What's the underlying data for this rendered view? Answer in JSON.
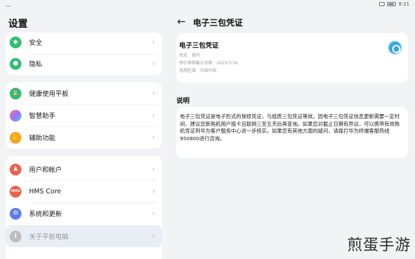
{
  "statusbar": {
    "wifi": "‿",
    "time": "8:21"
  },
  "settings_title": "设置",
  "groups": {
    "g1": [
      {
        "label": "安全",
        "icon": "shield-icon",
        "color": "#2fbf71"
      },
      {
        "label": "隐私",
        "icon": "privacy-icon",
        "color": "#2fbf71"
      }
    ],
    "g2": [
      {
        "label": "健康使用平板",
        "icon": "hourglass-icon",
        "color": "#2fbf71"
      },
      {
        "label": "智慧助手",
        "icon": "assistant-icon",
        "color": "#b36ef0"
      },
      {
        "label": "辅助功能",
        "icon": "hand-icon",
        "color": "#f5a623"
      }
    ],
    "g3": [
      {
        "label": "用户和帐户",
        "icon": "user-icon",
        "color": "#f0604a"
      },
      {
        "label": "HMS Core",
        "icon": "hms-icon",
        "color": "#f0604a"
      },
      {
        "label": "系统和更新",
        "icon": "system-update-icon",
        "color": "#5b7cf5"
      },
      {
        "label": "关于平板电脑",
        "icon": "info-icon",
        "color": "#bdbdbd"
      }
    ]
  },
  "page": {
    "back": "←",
    "title": "电子三包凭证"
  },
  "card": {
    "title": "电子三包凭证",
    "rows": [
      {
        "k": "状态",
        "v": "保内"
      },
      {
        "k": "预计保修截止日期",
        "v": "2023/7/18"
      },
      {
        "k": "适用区域",
        "v": "中国大陆"
      }
    ]
  },
  "section": {
    "title": "说明",
    "text": "电子三包凭证是电子形式的保修凭证，与纸质三包凭证等效。因电子三包凭证信息更新需要一定时间，建议您新购机用户插卡且联网三至五天后再查询。如果您对截止日期有异议，可以携带有效购机凭证到华为客户服务中心进一步核实。如果您有其他方面的疑问，请拨打华为终端客服热线950800进行咨询。"
  },
  "watermark": "煎蛋手游",
  "colors": {
    "accent": "#35a8e0",
    "background": "#f1f3f5"
  }
}
